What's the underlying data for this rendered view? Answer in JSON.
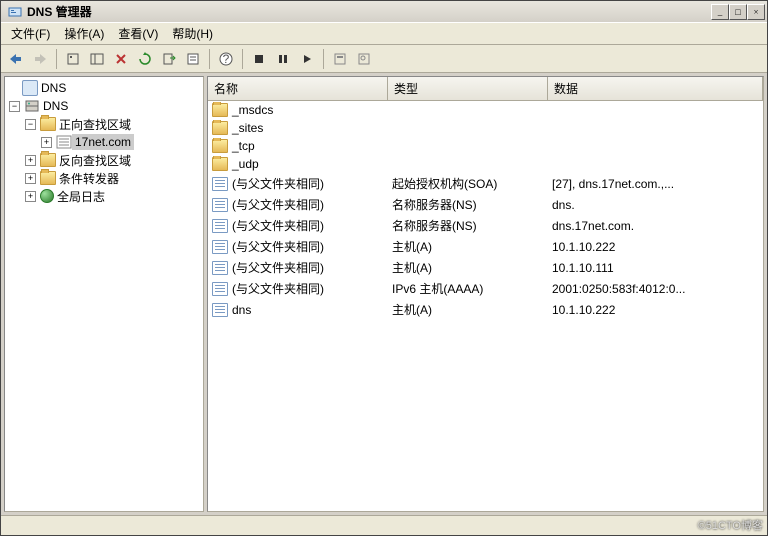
{
  "window": {
    "title": "DNS 管理器"
  },
  "menu": {
    "file": "文件(F)",
    "action": "操作(A)",
    "view": "查看(V)",
    "help": "帮助(H)"
  },
  "tree": {
    "root": "DNS",
    "server": "DNS",
    "forward": "正向查找区域",
    "zone": "17net.com",
    "reverse": "反向查找区域",
    "conditional": "条件转发器",
    "global_log": "全局日志"
  },
  "columns": {
    "name": "名称",
    "type": "类型",
    "data": "数据"
  },
  "rows": [
    {
      "icon": "folder",
      "name": "_msdcs",
      "type": "",
      "data": ""
    },
    {
      "icon": "folder",
      "name": "_sites",
      "type": "",
      "data": ""
    },
    {
      "icon": "folder",
      "name": "_tcp",
      "type": "",
      "data": ""
    },
    {
      "icon": "folder",
      "name": "_udp",
      "type": "",
      "data": ""
    },
    {
      "icon": "record",
      "name": "(与父文件夹相同)",
      "type": "起始授权机构(SOA)",
      "data": "[27], dns.17net.com.,..."
    },
    {
      "icon": "record",
      "name": "(与父文件夹相同)",
      "type": "名称服务器(NS)",
      "data": "dns."
    },
    {
      "icon": "record",
      "name": "(与父文件夹相同)",
      "type": "名称服务器(NS)",
      "data": "dns.17net.com."
    },
    {
      "icon": "record",
      "name": "(与父文件夹相同)",
      "type": "主机(A)",
      "data": "10.1.10.222"
    },
    {
      "icon": "record",
      "name": "(与父文件夹相同)",
      "type": "主机(A)",
      "data": "10.1.10.111"
    },
    {
      "icon": "record",
      "name": "(与父文件夹相同)",
      "type": "IPv6 主机(AAAA)",
      "data": "2001:0250:583f:4012:0..."
    },
    {
      "icon": "record",
      "name": "dns",
      "type": "主机(A)",
      "data": "10.1.10.222"
    }
  ],
  "watermark": "©51CTO博客"
}
